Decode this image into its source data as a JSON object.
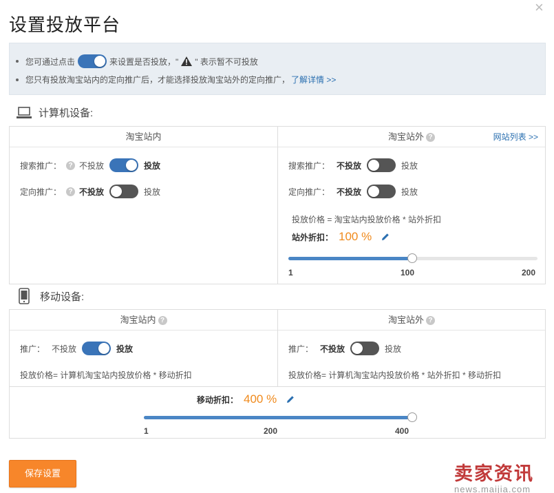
{
  "page": {
    "title": "设置投放平台"
  },
  "notice": {
    "line1_a": "您可通过点击",
    "line1_b": "来设置是否投放，\"",
    "line1_c": "\" 表示暂不可投放",
    "line2": "您只有投放淘宝站内的定向推广后，才能选择投放淘宝站外的定向推广，",
    "line2_link": "了解详情 >>"
  },
  "pc": {
    "heading": "计算机设备:",
    "inside": {
      "header": "淘宝站内",
      "search": {
        "label": "搜索推广：",
        "off": "不投放",
        "on": "投放",
        "state": "on"
      },
      "target": {
        "label": "定向推广：",
        "off": "不投放",
        "on": "投放",
        "state": "off"
      }
    },
    "outside": {
      "header": "淘宝站外",
      "site_list_link": "网站列表 >>",
      "search": {
        "label": "搜索推广：",
        "off": "不投放",
        "on": "投放",
        "state": "off"
      },
      "target": {
        "label": "定向推广：",
        "off": "不投放",
        "on": "投放",
        "state": "off"
      },
      "formula": "投放价格 = 淘宝站内投放价格 * 站外折扣",
      "discount_label": "站外折扣：",
      "discount_value": "100 %",
      "slider": {
        "min_label": "1",
        "mid_label": "100",
        "max_label": "200",
        "value": 100,
        "min": 1,
        "max": 200
      }
    }
  },
  "mobile": {
    "heading": "移动设备:",
    "inside": {
      "header": "淘宝站内",
      "promo": {
        "label": "推广：",
        "off": "不投放",
        "on": "投放",
        "state": "on"
      },
      "formula": "投放价格= 计算机淘宝站内投放价格 * 移动折扣"
    },
    "outside": {
      "header": "淘宝站外",
      "promo": {
        "label": "推广：",
        "off": "不投放",
        "on": "投放",
        "state": "off"
      },
      "formula": "投放价格= 计算机淘宝站内投放价格 * 站外折扣 * 移动折扣"
    },
    "discount_label": "移动折扣：",
    "discount_value": "400 %",
    "slider": {
      "min_label": "1",
      "mid_label": "200",
      "max_label": "400",
      "value": 400,
      "min": 1,
      "max": 400
    }
  },
  "buttons": {
    "save": "保存设置",
    "close": "×"
  },
  "watermark": {
    "big": "卖家资讯",
    "small": "news.maijia.com"
  },
  "colors": {
    "accent": "#3a74b8",
    "orange": "#f08a1c",
    "save": "#f7862a",
    "notice_bg": "#e9eef3"
  }
}
